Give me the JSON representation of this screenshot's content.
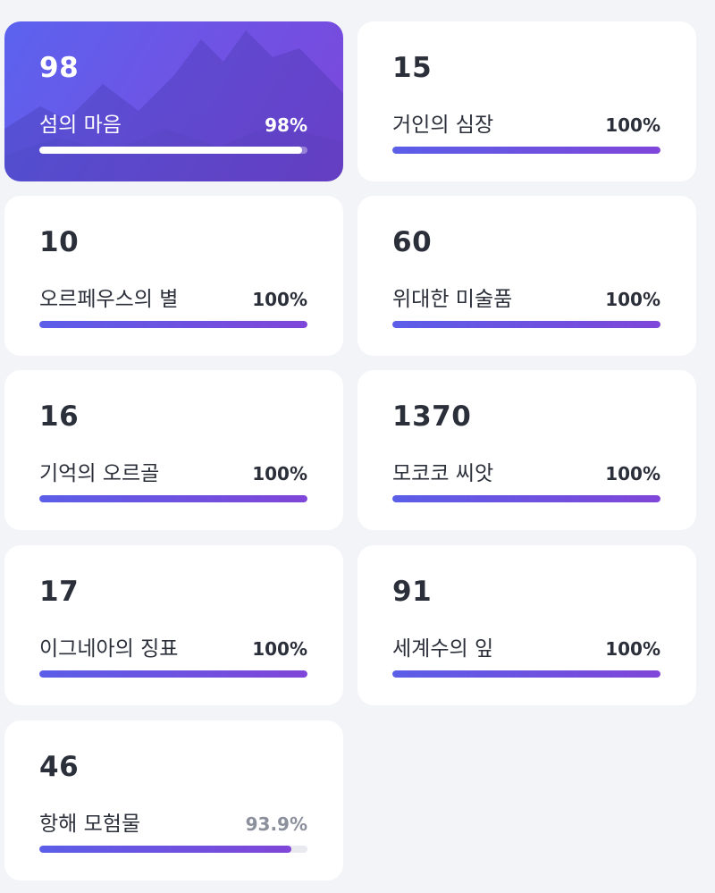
{
  "achievements": [
    {
      "count": "98",
      "name": "섬의 마음",
      "percent_label": "98%",
      "progress": 0.98,
      "active": true
    },
    {
      "count": "15",
      "name": "거인의 심장",
      "percent_label": "100%",
      "progress": 1.0
    },
    {
      "count": "10",
      "name": "오르페우스의 별",
      "percent_label": "100%",
      "progress": 1.0
    },
    {
      "count": "60",
      "name": "위대한 미술품",
      "percent_label": "100%",
      "progress": 1.0
    },
    {
      "count": "16",
      "name": "기억의 오르골",
      "percent_label": "100%",
      "progress": 1.0
    },
    {
      "count": "1370",
      "name": "모코코 씨앗",
      "percent_label": "100%",
      "progress": 1.0
    },
    {
      "count": "17",
      "name": "이그네아의 징표",
      "percent_label": "100%",
      "progress": 1.0
    },
    {
      "count": "91",
      "name": "세계수의 잎",
      "percent_label": "100%",
      "progress": 1.0
    },
    {
      "count": "46",
      "name": "항해 모험물",
      "percent_label": "93.9%",
      "progress": 0.939,
      "dim_percent": true
    }
  ],
  "colors": {
    "accent_start": "#5b5ee8",
    "accent_end": "#7f46d9",
    "text": "#2b2f3a",
    "muted": "#8b909c",
    "background": "#f3f4f8"
  },
  "icons": {
    "active_card_background": "mountain-landscape-art"
  }
}
